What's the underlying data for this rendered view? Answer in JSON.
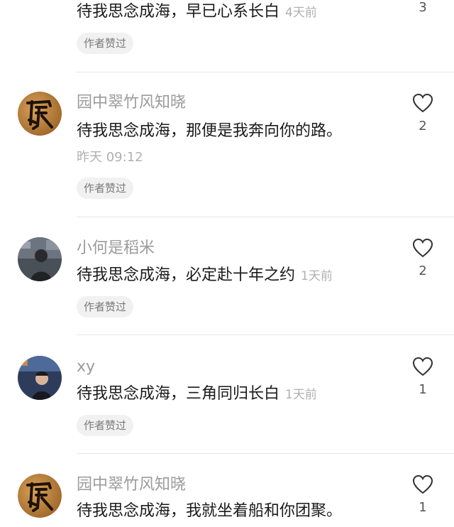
{
  "comments": [
    {
      "username": "",
      "text": "待我思念成海，早已心系长白",
      "time": "4天前",
      "badge": "作者赞过",
      "likes": "3",
      "avatar": "none"
    },
    {
      "username": "园中翠竹风知晓",
      "text": "待我思念成海，那便是我奔向你的路。",
      "time": "昨天 09:12",
      "badge": "作者赞过",
      "likes": "2",
      "avatar": "calligraphy-avatar"
    },
    {
      "username": "小何是稻米",
      "text": "待我思念成海，必定赴十年之约",
      "time": "1天前",
      "badge": "作者赞过",
      "likes": "2",
      "avatar": "photo-avatar-person"
    },
    {
      "username": "xy",
      "text": "待我思念成海，三角同归长白",
      "time": "1天前",
      "badge": "作者赞过",
      "likes": "1",
      "avatar": "photo-avatar-boy"
    },
    {
      "username": "园中翠竹风知晓",
      "text": "待我思念成海，我就坐着船和你团聚。",
      "time": "",
      "badge": "",
      "likes": "1",
      "avatar": "calligraphy-avatar"
    }
  ],
  "icons": {
    "like": "heart-outline-icon"
  },
  "colors": {
    "username": "#9b9b9b",
    "time": "#b0b0b0",
    "badge_bg": "#f1f1f1",
    "divider": "#e6e6e6"
  }
}
